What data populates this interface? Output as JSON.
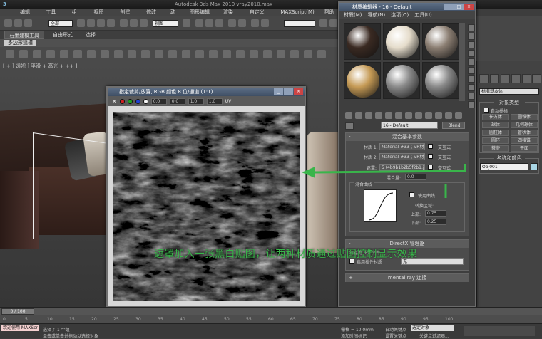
{
  "app": {
    "title": "Autodesk 3ds Max 2010    vray2010.max",
    "logo": "3"
  },
  "menus": [
    "编辑(E)",
    "工具(T)",
    "组(G)",
    "视图(V)",
    "创建(C)",
    "修改器",
    "动画",
    "图形编辑器",
    "渲染(R)",
    "自定义(U)",
    "MAXScript(M)",
    "帮助(H)"
  ],
  "toolbar": {
    "selection_filter": "全部",
    "ref_coord": "视图"
  },
  "ribbon": {
    "tabs": [
      "石墨建模工具",
      "自由形式",
      "选择"
    ],
    "poly_label": "多边形建模"
  },
  "viewport": {
    "label": "[ + ] 透视 ] 平滑 + 高光 + ++ ]"
  },
  "bitmap_window": {
    "title": "指定裁剪/放置, RGB 颜色 8 位/通道 (1:1)",
    "spinners": [
      "0.0",
      "0.0",
      "1.0",
      "1.0"
    ],
    "uv": "UV",
    "colors": [
      "#d02020",
      "#20a020",
      "#2040d0",
      "#f4f4f4"
    ]
  },
  "material_editor": {
    "title": "材质编辑器 - 16 - Default",
    "menus": [
      "材质(M)",
      "导航(N)",
      "选项(O)",
      "工具(U)"
    ],
    "spheres": [
      {
        "name": "dark-wood",
        "color": "#3a2a22"
      },
      {
        "name": "cream",
        "color": "#e5dccb"
      },
      {
        "name": "marble",
        "color": "#8b7e72"
      },
      {
        "name": "tan-leather",
        "color": "#c59a55"
      },
      {
        "name": "gray-1",
        "color": "#8a8a8a"
      },
      {
        "name": "gray-2",
        "color": "#888888"
      }
    ],
    "material_name": "16 - Default",
    "type_button": "Blend",
    "blend_rollout_title": "混合基本参数",
    "material1_label": "材质 1:",
    "material1_value": "Material #33 ( VR材质 )",
    "material2_label": "材质 2:",
    "material2_value": "Material #33 ( VR材质 )",
    "mask_label": "遮罩:",
    "mask_value": "5 (4b9b1b2b5f2b1.jpg)",
    "interactive_label": "交互式",
    "mix_amount_label": "混合量:",
    "mix_amount_value": "0.0",
    "mix_curve_title": "混合曲线",
    "use_curve_label": "使用曲线",
    "transition_label": "转换区域:",
    "upper_label": "上部:",
    "upper_value": "0.75",
    "lower_label": "下部:",
    "lower_value": "0.25",
    "directx_title": "DirectX 管理器",
    "directx_save_label": "保存为 .FX 文件",
    "directx_enable_label": "启用插件材质",
    "directx_none": "无",
    "mental_ray_title": "mental ray 连接"
  },
  "command_panel": {
    "category": "标准基本体",
    "object_type_title": "对象类型",
    "auto_grid": "自动栅格",
    "buttons": [
      "长方体",
      "圆锥体",
      "球体",
      "几何球体",
      "圆柱体",
      "管状体",
      "圆环",
      "四棱锥",
      "茶壶",
      "平面"
    ],
    "name_color_title": "名称和颜色",
    "object_name": "Obj001"
  },
  "annotation": {
    "text": "遮罩加入一张黑白贴图，让两种材质通过贴图控制显示效果",
    "color": "#39b54a"
  },
  "timeline": {
    "position": "0 / 100",
    "ticks": [
      "0",
      "5",
      "10",
      "15",
      "20",
      "25",
      "30",
      "35",
      "40",
      "45",
      "50",
      "55",
      "60",
      "65",
      "70",
      "75",
      "80",
      "85",
      "90",
      "95",
      "100"
    ]
  },
  "status": {
    "welcome": "欢迎使用 MAXScr",
    "selection": "选择了 1 个组",
    "prompt": "单击或单击并拖动以选择对象",
    "grid": "栅格 = 10.0mm",
    "autokey": "自动关键点",
    "selected": "选定对象",
    "setkey": "设置关键点",
    "keyfilter": "关键点过滤器...",
    "add_time_tag": "添加时间标记"
  }
}
